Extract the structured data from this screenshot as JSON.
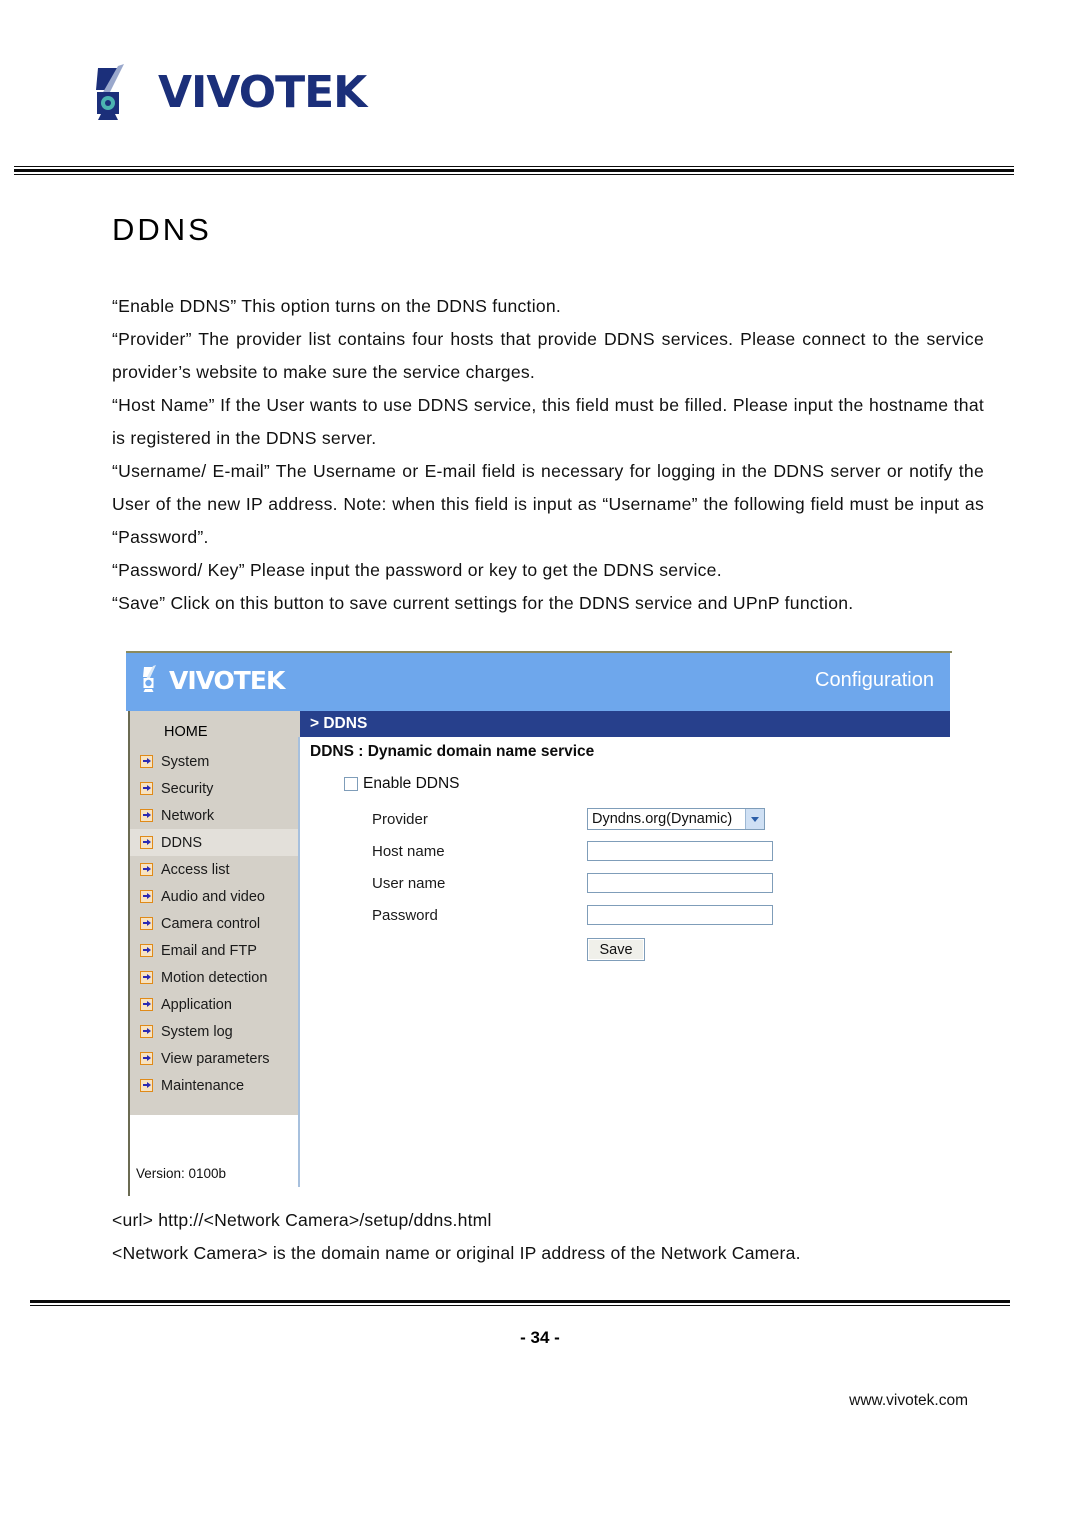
{
  "document": {
    "brand": "VIVOTEK",
    "title": "DDNS",
    "paragraphs": [
      "“Enable DDNS” This option turns on the DDNS function.",
      "“Provider” The provider list contains four hosts that provide DDNS services. Please connect to the service provider’s website to make sure the service charges.",
      "“Host Name” If the User wants to use DDNS service, this field must be filled. Please input the hostname that is registered in the DDNS server.",
      "“Username/ E-mail” The Username or E-mail field is necessary for logging in the DDNS server or notify the User of the new IP address. Note: when this field is input as “Username” the following field must be input as “Password”.",
      "“Password/ Key” Please input the password or key to get the DDNS service.",
      "“Save” Click on this button to save current settings for the DDNS service and UPnP function."
    ],
    "url_lines": [
      "<url> http://<Network Camera>/setup/ddns.html",
      "<Network Camera> is the domain name or original IP address of the Network Camera."
    ],
    "page_number": "- 34 -",
    "website": "www.vivotek.com"
  },
  "screenshot": {
    "banner": {
      "brand": "VIVOTEK",
      "section_label": "Configuration"
    },
    "breadcrumb": "> DDNS",
    "sidebar": {
      "home_label": "HOME",
      "items": [
        {
          "label": "System",
          "active": false
        },
        {
          "label": "Security",
          "active": false
        },
        {
          "label": "Network",
          "active": false
        },
        {
          "label": "DDNS",
          "active": true
        },
        {
          "label": "Access list",
          "active": false
        },
        {
          "label": "Audio and video",
          "active": false
        },
        {
          "label": "Camera control",
          "active": false
        },
        {
          "label": "Email and FTP",
          "active": false
        },
        {
          "label": "Motion detection",
          "active": false
        },
        {
          "label": "Application",
          "active": false
        },
        {
          "label": "System log",
          "active": false
        },
        {
          "label": "View parameters",
          "active": false
        },
        {
          "label": "Maintenance",
          "active": false
        }
      ],
      "version": "Version: 0100b"
    },
    "form": {
      "title": "DDNS : Dynamic domain name service",
      "enable_label": "Enable DDNS",
      "enable_checked": false,
      "fields": [
        {
          "label": "Provider",
          "type": "select",
          "value": "Dyndns.org(Dynamic)"
        },
        {
          "label": "Host name",
          "type": "text",
          "value": ""
        },
        {
          "label": "User name",
          "type": "text",
          "value": ""
        },
        {
          "label": "Password",
          "type": "text",
          "value": ""
        }
      ],
      "save_label": "Save"
    }
  },
  "colors": {
    "banner_blue": "#6ea7ec",
    "breadcrumb_blue": "#27408c",
    "sidebar_gray": "#d4d0c8",
    "icon_orange": "#e08a18",
    "logo_navy": "#1b2f7a"
  }
}
